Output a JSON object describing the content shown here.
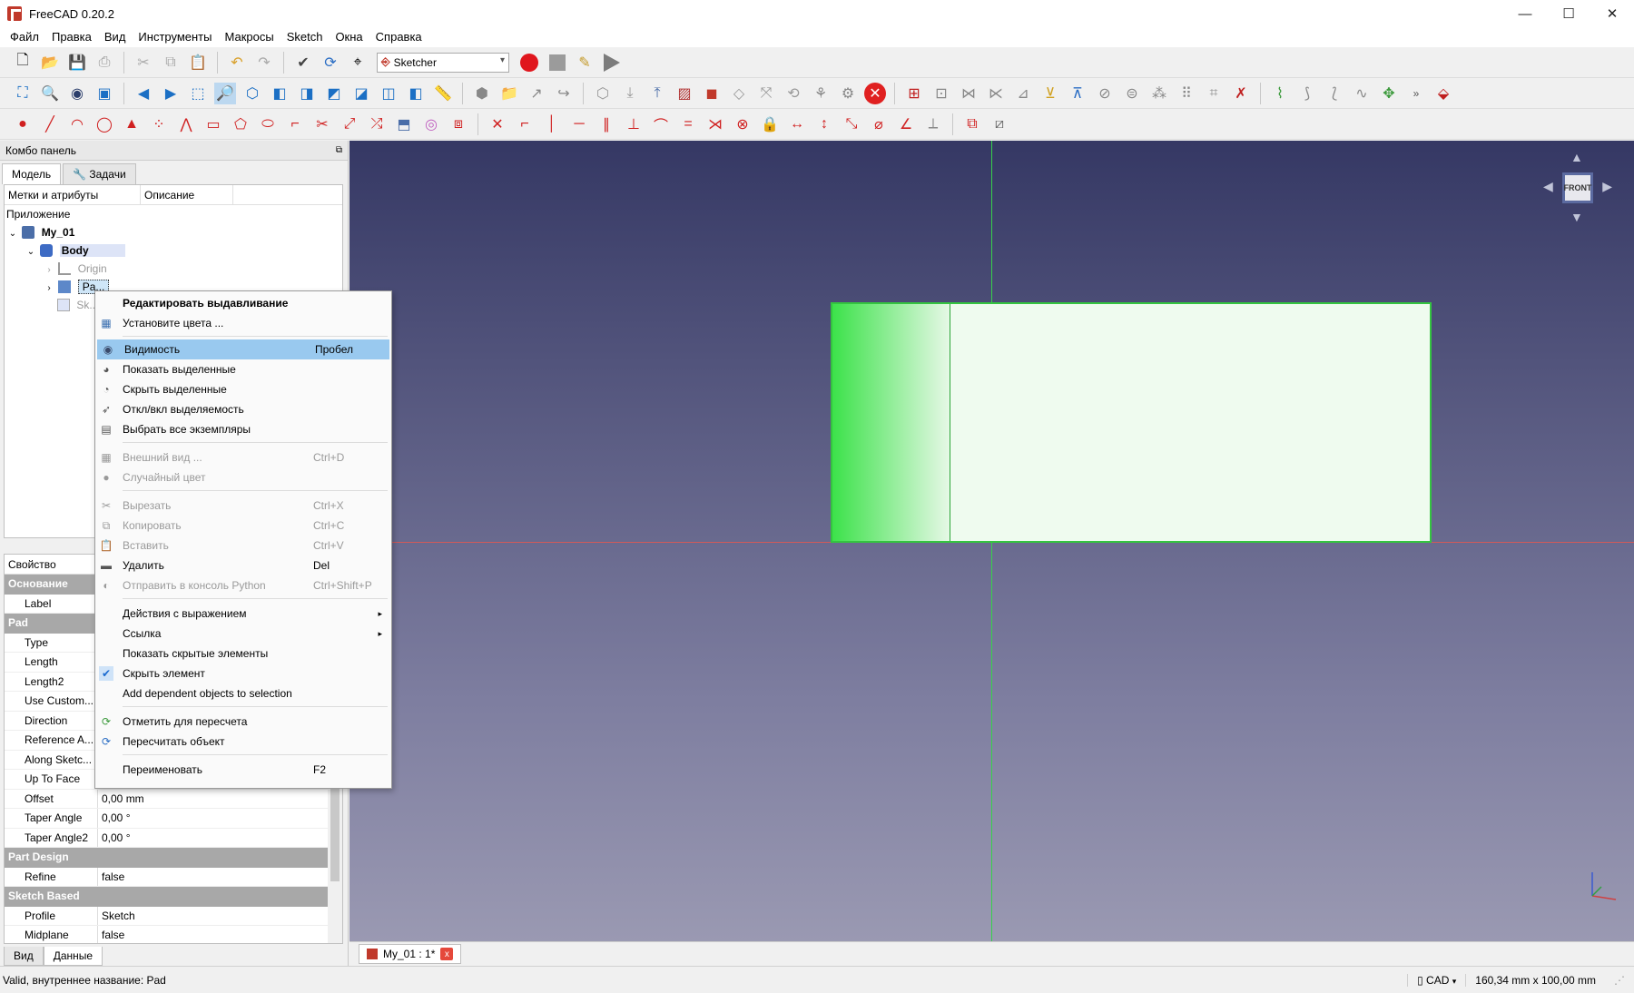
{
  "window": {
    "title": "FreeCAD 0.20.2",
    "minimize": "—",
    "maximize": "☐",
    "close": "✕"
  },
  "menubar": [
    "Файл",
    "Правка",
    "Вид",
    "Инструменты",
    "Макросы",
    "Sketch",
    "Окна",
    "Справка"
  ],
  "workbench": {
    "selected": "Sketcher"
  },
  "combo": {
    "title": "Комбо панель",
    "tabs": [
      "Модель",
      "Задачи"
    ],
    "tree_headers": [
      "Метки и атрибуты",
      "Описание"
    ],
    "tree": {
      "app_label": "Приложение",
      "doc": "My_01",
      "body": "Body",
      "origin": "Origin",
      "pad": "Pa...",
      "sketch": "Sk..."
    },
    "properties": {
      "header": "Свойство",
      "groups": {
        "base": "Основание",
        "pad": "Pad",
        "part_design": "Part Design",
        "sketch_based": "Sketch Based"
      },
      "base_rows": [
        {
          "name": "Label",
          "value": ""
        }
      ],
      "pad_rows": [
        {
          "name": "Type",
          "value": ""
        },
        {
          "name": "Length",
          "value": ""
        },
        {
          "name": "Length2",
          "value": ""
        },
        {
          "name": "Use Custom...",
          "value": ""
        },
        {
          "name": "Direction",
          "value": ""
        },
        {
          "name": "Reference A...",
          "value": ""
        },
        {
          "name": "Along Sketc...",
          "value": ""
        },
        {
          "name": "Up To Face",
          "value": ""
        },
        {
          "name": "Offset",
          "value": "0,00 mm"
        },
        {
          "name": "Taper Angle",
          "value": "0,00 °"
        },
        {
          "name": "Taper Angle2",
          "value": "0,00 °"
        }
      ],
      "part_design_rows": [
        {
          "name": "Refine",
          "value": "false"
        }
      ],
      "sketch_based_rows": [
        {
          "name": "Profile",
          "value": "Sketch"
        },
        {
          "name": "Midplane",
          "value": "false"
        }
      ]
    },
    "bottom_tabs": [
      "Вид",
      "Данные"
    ]
  },
  "context_menu": {
    "items": [
      {
        "label": "Редактировать выдавливание",
        "shortcut": "",
        "bold": true
      },
      {
        "label": "Установите цвета ...",
        "shortcut": ""
      },
      {
        "label": "Видимость",
        "shortcut": "Пробел"
      },
      {
        "label": "Показать выделенные",
        "shortcut": ""
      },
      {
        "label": "Скрыть выделенные",
        "shortcut": ""
      },
      {
        "label": "Откл/вкл выделяемость",
        "shortcut": ""
      },
      {
        "label": "Выбрать все экземпляры",
        "shortcut": ""
      },
      {
        "label": "Внешний вид ...",
        "shortcut": "Ctrl+D"
      },
      {
        "label": "Случайный цвет",
        "shortcut": ""
      },
      {
        "label": "Вырезать",
        "shortcut": "Ctrl+X"
      },
      {
        "label": "Копировать",
        "shortcut": "Ctrl+C"
      },
      {
        "label": "Вставить",
        "shortcut": "Ctrl+V"
      },
      {
        "label": "Удалить",
        "shortcut": "Del"
      },
      {
        "label": "Отправить в консоль Python",
        "shortcut": "Ctrl+Shift+P"
      },
      {
        "label": "Действия с выражением",
        "shortcut": ""
      },
      {
        "label": "Ссылка",
        "shortcut": ""
      },
      {
        "label": "Показать скрытые элементы",
        "shortcut": ""
      },
      {
        "label": "Скрыть элемент",
        "shortcut": ""
      },
      {
        "label": "Add dependent objects to selection",
        "shortcut": ""
      },
      {
        "label": "Отметить для пересчета",
        "shortcut": ""
      },
      {
        "label": "Пересчитать объект",
        "shortcut": ""
      },
      {
        "label": "Переименовать",
        "shortcut": "F2"
      }
    ],
    "submenu_arrow": "▸",
    "checkmark": "✔"
  },
  "view": {
    "navcube_face": "FRONT"
  },
  "doc_tab": {
    "label": "My_01 : 1*",
    "close": "x"
  },
  "status": {
    "left": "Valid, внутреннее название: Pad",
    "nav_style": "CAD",
    "dimensions": "160,34 mm x 100,00 mm"
  },
  "colors": {
    "accent_highlight": "#99c9ef",
    "pad_edge": "#34c440",
    "stop_red": "#e0161d"
  }
}
